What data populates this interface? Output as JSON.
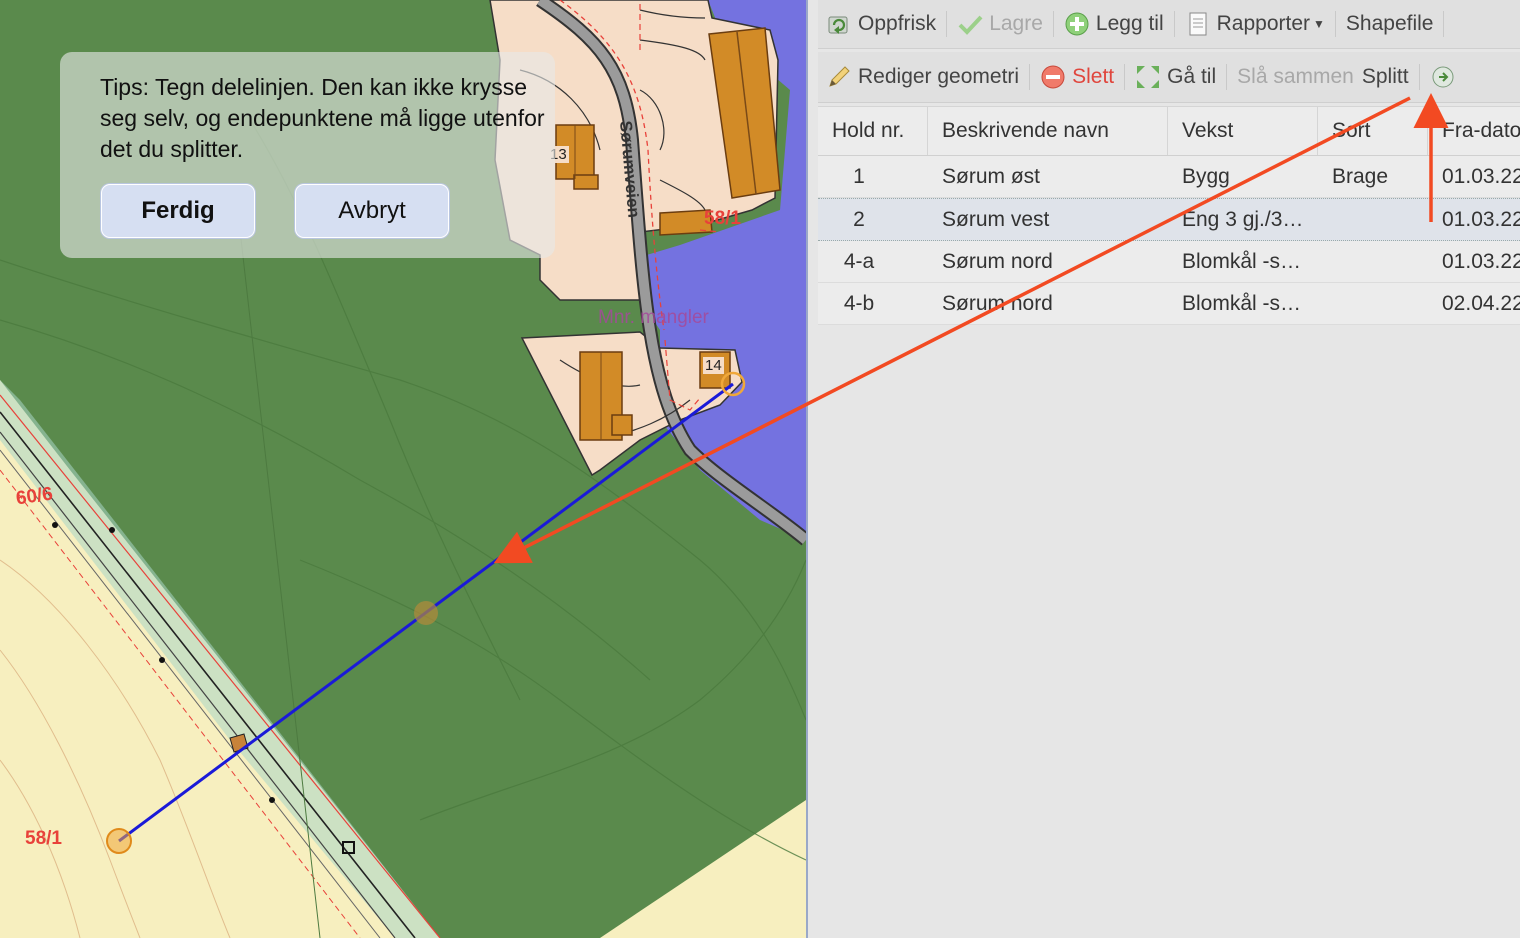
{
  "tip": {
    "text": "Tips: Tegn delelinjen. Den kan ikke krysse seg selv, og endepunktene må ligge utenfor det du splitter.",
    "done_label": "Ferdig",
    "cancel_label": "Avbryt"
  },
  "map": {
    "labels": {
      "parcel_58_1_top": "58/1",
      "parcel_58_1_bottom": "58/1",
      "parcel_60_6": "60/6",
      "house_13": "13",
      "house_14": "14",
      "road": "Sørumveien",
      "mnr_missing": "Mnr. mangler"
    },
    "colors": {
      "field": "#5a8a4c",
      "farmyard": "#f6ddc7",
      "water": "#7472e0",
      "meadow": "#f7efbf",
      "building": "#d28b27",
      "split_line": "#1a1ad8",
      "annotation_arrow": "#f24a22"
    }
  },
  "toolbar1": {
    "refresh": "Oppfrisk",
    "save": "Lagre",
    "add": "Legg til",
    "reports": "Rapporter",
    "shapefile": "Shapefile"
  },
  "toolbar2": {
    "edit_geometry": "Rediger geometri",
    "delete": "Slett",
    "goto": "Gå til",
    "merge": "Slå sammen",
    "split": "Splitt"
  },
  "table": {
    "headers": [
      "Hold nr.",
      "Beskrivende navn",
      "Vekst",
      "Sort",
      "Fra-dato"
    ],
    "rows": [
      {
        "hold": "1",
        "name": "Sørum øst",
        "crop": "Bygg",
        "variety": "Brage",
        "from": "01.03.22"
      },
      {
        "hold": "2",
        "name": "Sørum vest",
        "crop": "Eng 3 gj./3…",
        "variety": "",
        "from": "01.03.22"
      },
      {
        "hold": "4-a",
        "name": "Sørum nord",
        "crop": "Blomkål -s…",
        "variety": "",
        "from": "01.03.22"
      },
      {
        "hold": "4-b",
        "name": "Sørum nord",
        "crop": "Blomkål -s…",
        "variety": "",
        "from": "02.04.22"
      }
    ],
    "selected_row": 1
  }
}
